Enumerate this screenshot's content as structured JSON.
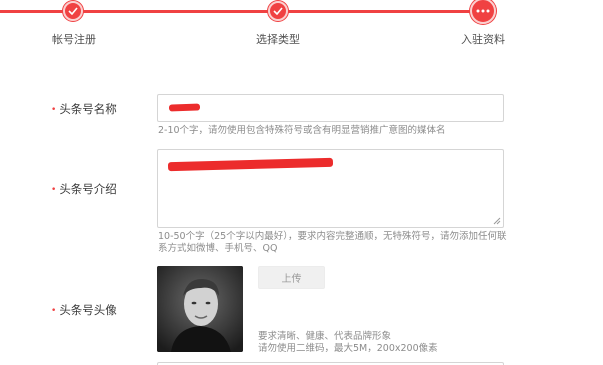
{
  "colors": {
    "accent": "#f04142",
    "redaction": "#ec2c2c"
  },
  "steps": [
    {
      "label": "帐号注册",
      "state": "done",
      "icon": "check-icon"
    },
    {
      "label": "选择类型",
      "state": "done",
      "icon": "check-icon"
    },
    {
      "label": "入驻资料",
      "state": "current",
      "icon": "more-dots-icon"
    }
  ],
  "form": {
    "name": {
      "label": "头条号名称",
      "value": "",
      "hint": "2-10个字，请勿使用包含特殊符号或含有明显营销推广意图的媒体名"
    },
    "intro": {
      "label": "头条号介绍",
      "value": "",
      "hint_line1": "10-50个字（25个字以内最好），要求内容完整通顺，无特殊符号，请勿添加任何联",
      "hint_line2": "系方式如微博、手机号、QQ"
    },
    "avatar": {
      "label": "头条号头像",
      "upload_label": "上传",
      "hint_line1": "要求清晰、健康、代表品牌形象",
      "hint_line2": "请勿使用二维码，最大5M，200x200像素"
    }
  }
}
